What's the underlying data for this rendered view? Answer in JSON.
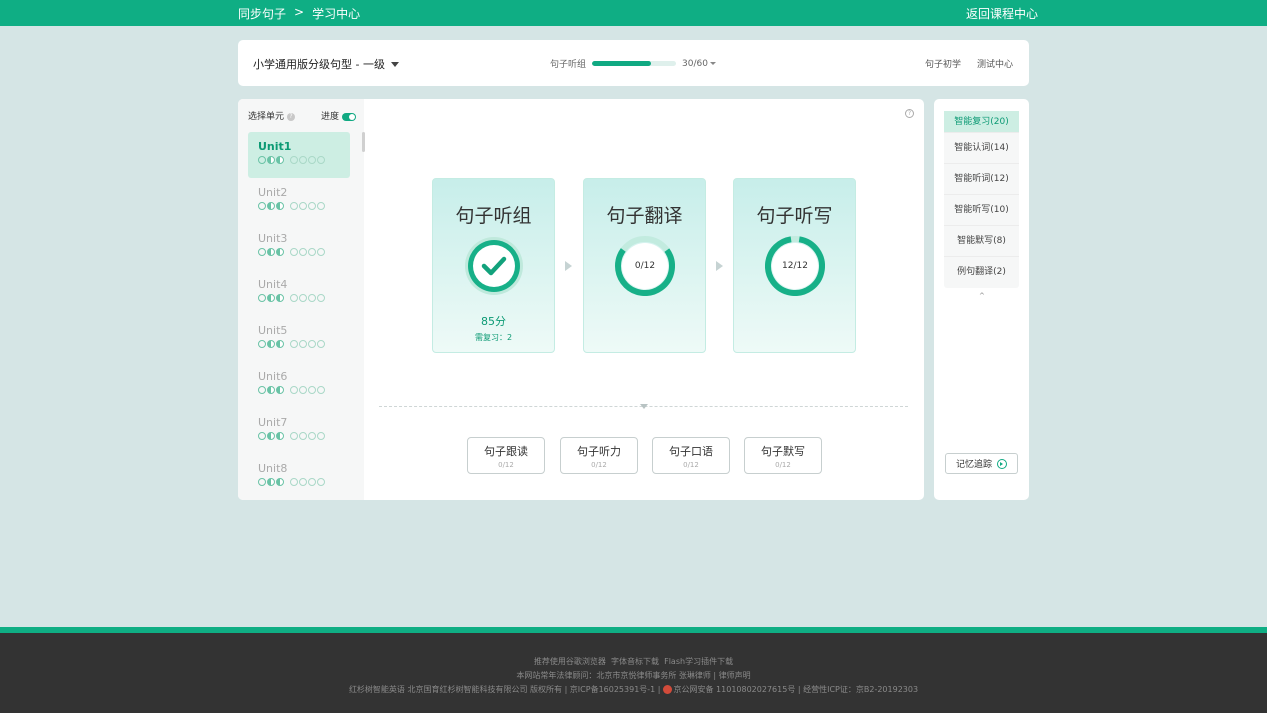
{
  "topbar": {
    "crumb1": "同步句子",
    "sep": ">",
    "crumb2": "学习中心",
    "back": "返回课程中心"
  },
  "header": {
    "course": "小学通用版分级句型 - 一级",
    "progress_label": "句子听组",
    "progress_value": "30/60",
    "progress_fraction": 0.7,
    "links": [
      "句子初学",
      "测试中心"
    ]
  },
  "units": {
    "select_label": "选择单元",
    "progress_label": "进度",
    "items": [
      {
        "name": "Unit1",
        "active": true
      },
      {
        "name": "Unit2",
        "active": false
      },
      {
        "name": "Unit3",
        "active": false
      },
      {
        "name": "Unit4",
        "active": false
      },
      {
        "name": "Unit5",
        "active": false
      },
      {
        "name": "Unit6",
        "active": false
      },
      {
        "name": "Unit7",
        "active": false
      },
      {
        "name": "Unit8",
        "active": false
      }
    ]
  },
  "cards": [
    {
      "title": "句子听组",
      "status": "complete",
      "score": "85分",
      "review": "需复习：2"
    },
    {
      "title": "句子翻译",
      "progress": "0/12",
      "fraction": 0.7
    },
    {
      "title": "句子听写",
      "progress": "12/12",
      "fraction": 0.95
    }
  ],
  "practice": [
    {
      "title": "句子跟读",
      "count": "0/12"
    },
    {
      "title": "句子听力",
      "count": "0/12"
    },
    {
      "title": "句子口语",
      "count": "0/12"
    },
    {
      "title": "句子默写",
      "count": "0/12"
    }
  ],
  "smart": {
    "items": [
      "智能复习(20)",
      "智能认词(14)",
      "智能听词(12)",
      "智能听写(10)",
      "智能默写(8)",
      "例句翻译(2)"
    ],
    "caret": "^",
    "memory": "记忆追踪"
  },
  "footer": {
    "line1": [
      "推荐使用谷歌浏览器",
      "字体音标下载",
      "Flash学习插件下载"
    ],
    "line2": "本网站常年法律顾问：北京市京悦律师事务所 张琳律师 | 律师声明",
    "line3a": "红杉树智能英语 北京国育红杉树智能科技有限公司 版权所有 | 京ICP备16025391号-1 |",
    "line3b": "京公网安备 11010802027615号 | 经营性ICP证：京B2-20192303"
  },
  "colors": {
    "brand": "#0fae84",
    "accent_dark": "#0c9a74",
    "background": "#d5e5e5"
  }
}
